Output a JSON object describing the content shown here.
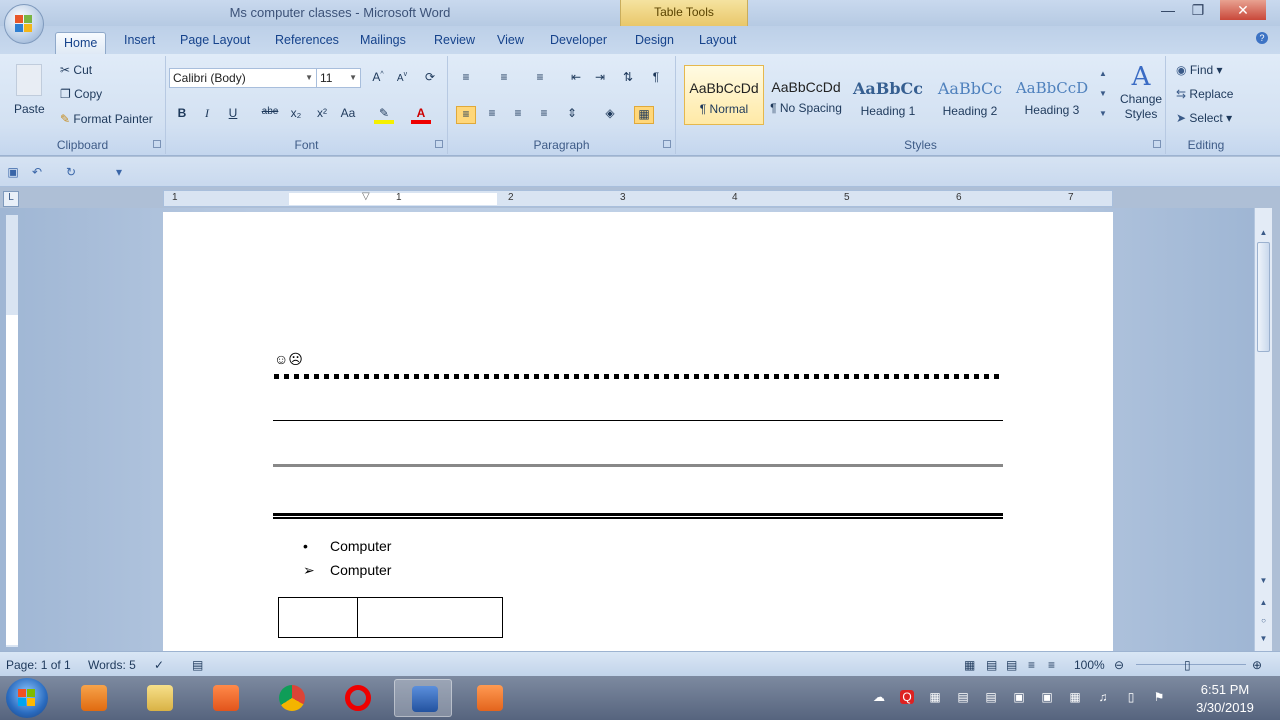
{
  "window": {
    "title": "Ms computer classes - Microsoft Word",
    "contextual_tab": "Table Tools"
  },
  "tabs": [
    "Home",
    "Insert",
    "Page Layout",
    "References",
    "Mailings",
    "Review",
    "View",
    "Developer",
    "Design",
    "Layout"
  ],
  "clipboard": {
    "paste": "Paste",
    "cut": "Cut",
    "copy": "Copy",
    "format_painter": "Format Painter",
    "label": "Clipboard"
  },
  "font": {
    "name": "Calibri (Body)",
    "size": "11",
    "label": "Font",
    "bold": "B",
    "italic": "I",
    "underline": "U",
    "strike": "abe",
    "sub": "x₂",
    "sup": "x²",
    "case": "Aa"
  },
  "paragraph": {
    "label": "Paragraph"
  },
  "styles": {
    "label": "Styles",
    "items": [
      {
        "sample": "AaBbCcDd",
        "name": "¶ Normal"
      },
      {
        "sample": "AaBbCcDd",
        "name": "¶ No Spacing"
      },
      {
        "sample": "AaBbCc",
        "name": "Heading 1"
      },
      {
        "sample": "AaBbCc",
        "name": "Heading 2"
      },
      {
        "sample": "AaBbCcD",
        "name": "Heading 3"
      }
    ],
    "change_styles": "Change Styles"
  },
  "editing": {
    "label": "Editing",
    "find": "Find",
    "replace": "Replace",
    "select": "Select"
  },
  "ruler": {
    "numbers": [
      "1",
      "1",
      "2",
      "3",
      "4",
      "5",
      "6",
      "7"
    ]
  },
  "document": {
    "symbols": "☺☹",
    "bullets": [
      {
        "marker": "•",
        "text": "Computer"
      },
      {
        "marker": "➢",
        "text": "Computer"
      }
    ]
  },
  "status": {
    "page": "Page: 1 of 1",
    "words": "Words: 5",
    "zoom": "100%"
  },
  "taskbar": {
    "time": "6:51 PM",
    "date": "3/30/2019"
  }
}
